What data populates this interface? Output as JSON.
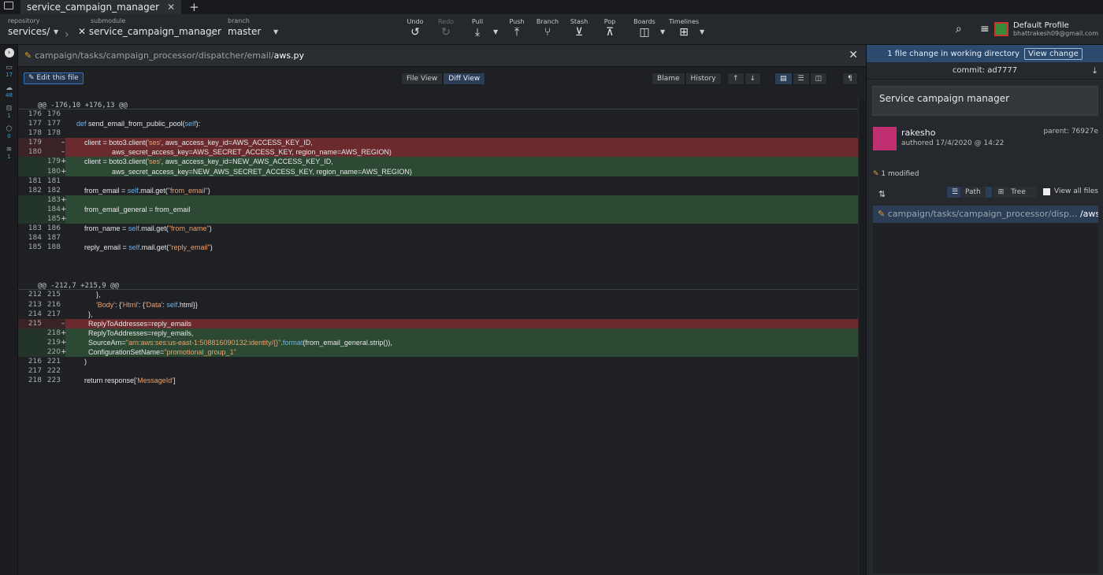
{
  "tabbar": {
    "tab_title": "service_campaign_manager",
    "close": "✕",
    "add": "+"
  },
  "toolbar": {
    "repository_label": "repository",
    "repository_value": "services/",
    "submodule_label": "submodule",
    "submodule_value": "service_campaign_manager",
    "branch_label": "branch",
    "branch_value": "master",
    "undo": "Undo",
    "redo": "Redo",
    "pull": "Pull",
    "push": "Push",
    "branch": "Branch",
    "stash": "Stash",
    "pop": "Pop",
    "boards": "Boards",
    "timelines": "Timelines",
    "profile_name": "Default Profile",
    "profile_email": "bhattrakesh09@gmail.com"
  },
  "left_icons": [
    {
      "count": "17"
    },
    {
      "count": "48"
    },
    {
      "count": "1"
    },
    {
      "count": "0"
    },
    {
      "count": "1"
    }
  ],
  "pathbar": {
    "path_dim": "campaign/tasks/campaign_processor/dispatcher/email/",
    "file": "aws.py"
  },
  "diffbar": {
    "edit": "Edit this file",
    "file_view": "File View",
    "diff_view": "Diff View",
    "blame": "Blame",
    "history": "History"
  },
  "hunks": [
    {
      "header": "@@ -176,10 +176,13 @@",
      "rows": [
        {
          "t": "ctx",
          "o": "176",
          "n": "176",
          "c": ""
        },
        {
          "t": "ctx",
          "o": "177",
          "n": "177",
          "c": "def send_email_from_public_pool(self):"
        },
        {
          "t": "ctx",
          "o": "178",
          "n": "178",
          "c": ""
        },
        {
          "t": "del",
          "o": "179",
          "n": "",
          "c": "    client = boto3.client('ses', aws_access_key_id=AWS_ACCESS_KEY_ID,"
        },
        {
          "t": "del",
          "o": "180",
          "n": "",
          "c": "                  aws_secret_access_key=AWS_SECRET_ACCESS_KEY, region_name=AWS_REGION)"
        },
        {
          "t": "add",
          "o": "",
          "n": "179",
          "c": "    client = boto3.client('ses', aws_access_key_id=NEW_AWS_ACCESS_KEY_ID,"
        },
        {
          "t": "add",
          "o": "",
          "n": "180",
          "c": "                  aws_secret_access_key=NEW_AWS_SECRET_ACCESS_KEY, region_name=AWS_REGION)"
        },
        {
          "t": "ctx",
          "o": "181",
          "n": "181",
          "c": ""
        },
        {
          "t": "ctx",
          "o": "182",
          "n": "182",
          "c": "    from_email = self.mail.get(\"from_email\")"
        },
        {
          "t": "add",
          "o": "",
          "n": "183",
          "c": ""
        },
        {
          "t": "add",
          "o": "",
          "n": "184",
          "c": "    from_email_general = from_email"
        },
        {
          "t": "add",
          "o": "",
          "n": "185",
          "c": ""
        },
        {
          "t": "ctx",
          "o": "183",
          "n": "186",
          "c": "    from_name = self.mail.get(\"from_name\")"
        },
        {
          "t": "ctx",
          "o": "184",
          "n": "187",
          "c": ""
        },
        {
          "t": "ctx",
          "o": "185",
          "n": "188",
          "c": "    reply_email = self.mail.get(\"reply_email\")"
        }
      ]
    },
    {
      "header": "@@ -212,7 +215,9 @@",
      "rows": [
        {
          "t": "ctx",
          "o": "212",
          "n": "215",
          "c": "          },"
        },
        {
          "t": "ctx",
          "o": "213",
          "n": "216",
          "c": "          'Body': {'Html': {'Data': self.html}}"
        },
        {
          "t": "ctx",
          "o": "214",
          "n": "217",
          "c": "      },"
        },
        {
          "t": "del",
          "o": "215",
          "n": "",
          "c": "      ReplyToAddresses=reply_emails"
        },
        {
          "t": "add",
          "o": "",
          "n": "218",
          "c": "      ReplyToAddresses=reply_emails,"
        },
        {
          "t": "add",
          "o": "",
          "n": "219",
          "c": "      SourceArn=\"arn:aws:ses:us-east-1:508816090132:identity/{}\".format(from_email_general.strip()),"
        },
        {
          "t": "add",
          "o": "",
          "n": "220",
          "c": "      ConfigurationSetName=\"promotional_group_1\""
        },
        {
          "t": "ctx",
          "o": "216",
          "n": "221",
          "c": "    )"
        },
        {
          "t": "ctx",
          "o": "217",
          "n": "222",
          "c": ""
        },
        {
          "t": "ctx",
          "o": "218",
          "n": "223",
          "c": "    return response['MessageId']"
        }
      ]
    }
  ],
  "right_panel": {
    "wd_text": "1 file change in working directory",
    "view_change": "View change",
    "commit": "commit: ad7777",
    "message": "Service campaign manager",
    "author": "rakesho",
    "authored": "authored",
    "date": "17/4/2020 @ 14:22",
    "parent": "parent: 76927e",
    "modified": "1 modified",
    "path": "Path",
    "tree": "Tree",
    "view_all": "View all files",
    "file_path_dim": "campaign/tasks/campaign_processor/disp... ",
    "file_name": "/aws.py"
  }
}
